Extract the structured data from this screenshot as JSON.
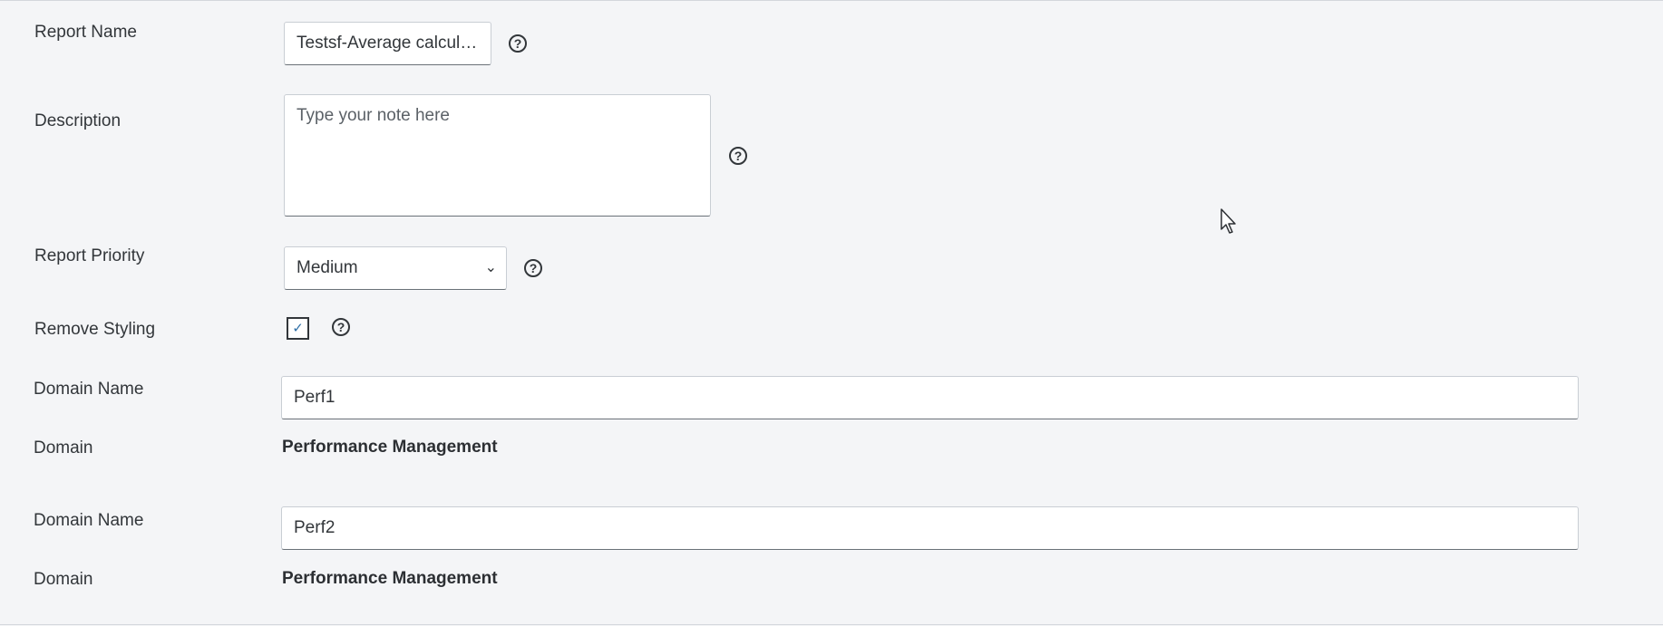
{
  "form": {
    "report_name": {
      "label": "Report Name",
      "value": "Testsf-Average calculation"
    },
    "description": {
      "label": "Description",
      "placeholder": "Type your note here"
    },
    "report_priority": {
      "label": "Report Priority",
      "selected": "Medium"
    },
    "remove_styling": {
      "label": "Remove Styling",
      "checked": true,
      "check_glyph": "✓"
    },
    "domains": [
      {
        "name_label": "Domain Name",
        "name_value": "Perf1",
        "domain_label": "Domain",
        "domain_value": "Performance Management"
      },
      {
        "name_label": "Domain Name",
        "name_value": "Perf2",
        "domain_label": "Domain",
        "domain_value": "Performance Management"
      }
    ]
  },
  "icons": {
    "help": "?",
    "chevron": "⌄"
  }
}
